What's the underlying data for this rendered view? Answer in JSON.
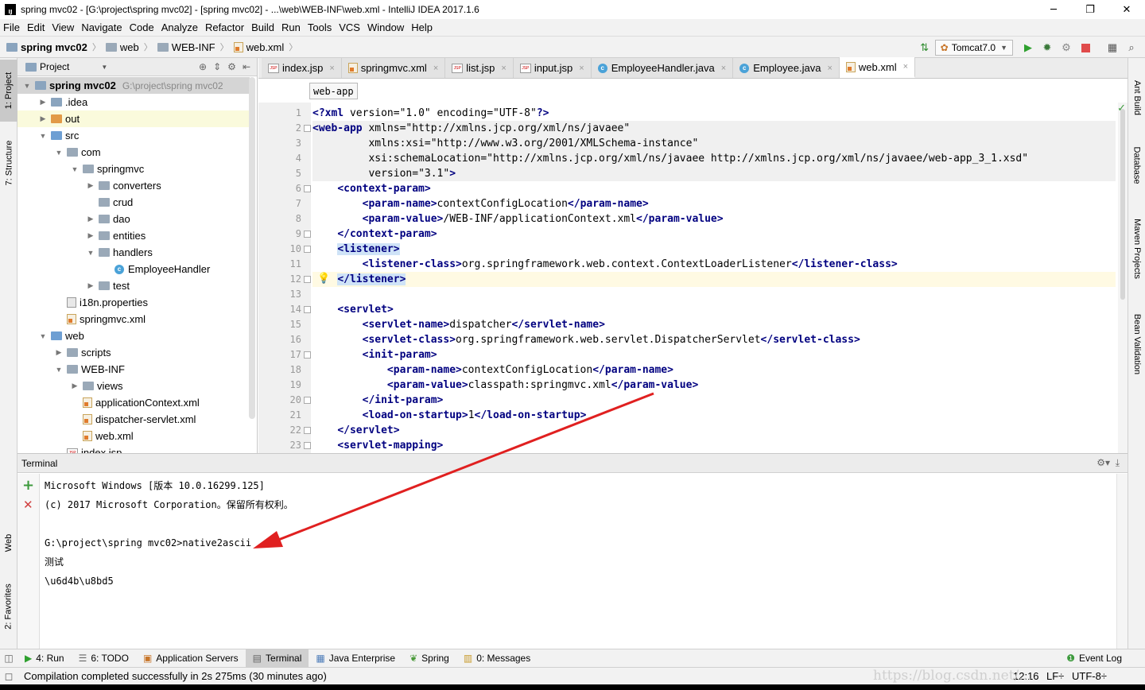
{
  "window": {
    "title": "spring mvc02 - [G:\\project\\spring mvc02] - [spring mvc02] - ...\\web\\WEB-INF\\web.xml - IntelliJ IDEA 2017.1.6",
    "logo": "IJ",
    "minimize": "─",
    "maximize": "❐",
    "close": "✕"
  },
  "menu": [
    "File",
    "Edit",
    "View",
    "Navigate",
    "Code",
    "Analyze",
    "Refactor",
    "Build",
    "Run",
    "Tools",
    "VCS",
    "Window",
    "Help"
  ],
  "breadcrumbs": [
    "spring mvc02",
    "web",
    "WEB-INF",
    "web.xml"
  ],
  "runconfig": {
    "name": "Tomcat7.0"
  },
  "leftstrip": [
    "1: Project",
    "7: Structure",
    "Web",
    "2: Favorites"
  ],
  "rightstrip": [
    "Ant Build",
    "Database",
    "Maven Projects",
    "Bean Validation"
  ],
  "project": {
    "header": "Project",
    "tree": [
      {
        "label": "spring mvc02",
        "path": "G:\\project\\spring mvc02",
        "depth": 0,
        "arrow": "▼",
        "icon": "folder",
        "bold": true
      },
      {
        "label": ".idea",
        "depth": 1,
        "arrow": "▶",
        "icon": "folder"
      },
      {
        "label": "out",
        "depth": 1,
        "arrow": "▶",
        "icon": "folder-orange"
      },
      {
        "label": "src",
        "depth": 1,
        "arrow": "▼",
        "icon": "folder-blue"
      },
      {
        "label": "com",
        "depth": 2,
        "arrow": "▼",
        "icon": "folder-gray"
      },
      {
        "label": "springmvc",
        "depth": 3,
        "arrow": "▼",
        "icon": "folder-gray"
      },
      {
        "label": "converters",
        "depth": 4,
        "arrow": "▶",
        "icon": "folder-gray"
      },
      {
        "label": "crud",
        "depth": 4,
        "arrow": "",
        "icon": "folder-gray"
      },
      {
        "label": "dao",
        "depth": 4,
        "arrow": "▶",
        "icon": "folder-gray"
      },
      {
        "label": "entities",
        "depth": 4,
        "arrow": "▶",
        "icon": "folder-gray"
      },
      {
        "label": "handlers",
        "depth": 4,
        "arrow": "▼",
        "icon": "folder-gray"
      },
      {
        "label": "EmployeeHandler",
        "depth": 5,
        "arrow": "",
        "icon": "class"
      },
      {
        "label": "test",
        "depth": 4,
        "arrow": "▶",
        "icon": "folder-gray"
      },
      {
        "label": "i18n.properties",
        "depth": 2,
        "arrow": "",
        "icon": "prop"
      },
      {
        "label": "springmvc.xml",
        "depth": 2,
        "arrow": "",
        "icon": "xml"
      },
      {
        "label": "web",
        "depth": 1,
        "arrow": "▼",
        "icon": "folder-blue"
      },
      {
        "label": "scripts",
        "depth": 2,
        "arrow": "▶",
        "icon": "folder-gray"
      },
      {
        "label": "WEB-INF",
        "depth": 2,
        "arrow": "▼",
        "icon": "folder-gray"
      },
      {
        "label": "views",
        "depth": 3,
        "arrow": "▶",
        "icon": "folder-gray"
      },
      {
        "label": "applicationContext.xml",
        "depth": 3,
        "arrow": "",
        "icon": "xml"
      },
      {
        "label": "dispatcher-servlet.xml",
        "depth": 3,
        "arrow": "",
        "icon": "xml"
      },
      {
        "label": "web.xml",
        "depth": 3,
        "arrow": "",
        "icon": "xml"
      },
      {
        "label": "index.jsp",
        "depth": 2,
        "arrow": "",
        "icon": "jsp"
      }
    ]
  },
  "tabs": [
    {
      "label": "index.jsp",
      "icon": "jsp"
    },
    {
      "label": "springmvc.xml",
      "icon": "xml"
    },
    {
      "label": "list.jsp",
      "icon": "jsp"
    },
    {
      "label": "input.jsp",
      "icon": "jsp"
    },
    {
      "label": "EmployeeHandler.java",
      "icon": "class"
    },
    {
      "label": "Employee.java",
      "icon": "class"
    },
    {
      "label": "web.xml",
      "icon": "xml",
      "active": true
    }
  ],
  "tab_close": "×",
  "crumb_tip": "web-app",
  "code": [
    "<?xml version=\"1.0\" encoding=\"UTF-8\"?>",
    "<web-app xmlns=\"http://xmlns.jcp.org/xml/ns/javaee\"",
    "         xmlns:xsi=\"http://www.w3.org/2001/XMLSchema-instance\"",
    "         xsi:schemaLocation=\"http://xmlns.jcp.org/xml/ns/javaee http://xmlns.jcp.org/xml/ns/javaee/web-app_3_1.xsd\"",
    "         version=\"3.1\">",
    "    <context-param>",
    "        <param-name>contextConfigLocation</param-name>",
    "        <param-value>/WEB-INF/applicationContext.xml</param-value>",
    "    </context-param>",
    "    <listener>",
    "        <listener-class>org.springframework.web.context.ContextLoaderListener</listener-class>",
    "    </listener>",
    "",
    "    <servlet>",
    "        <servlet-name>dispatcher</servlet-name>",
    "        <servlet-class>org.springframework.web.servlet.DispatcherServlet</servlet-class>",
    "        <init-param>",
    "            <param-name>contextConfigLocation</param-name>",
    "            <param-value>classpath:springmvc.xml</param-value>",
    "        </init-param>",
    "        <load-on-startup>1</load-on-startup>",
    "    </servlet>",
    "    <servlet-mapping>"
  ],
  "terminal": {
    "title": "Terminal",
    "lines": [
      "Microsoft Windows [版本 10.0.16299.125]",
      "(c) 2017 Microsoft Corporation。保留所有权利。",
      "",
      "G:\\project\\spring mvc02>native2ascii",
      "测试",
      "\\u6d4b\\u8bd5"
    ]
  },
  "bottomtabs": [
    {
      "label": "4: Run",
      "icon": "▶"
    },
    {
      "label": "6: TODO",
      "icon": "☰"
    },
    {
      "label": "Application Servers",
      "icon": "▣"
    },
    {
      "label": "Terminal",
      "icon": "▤",
      "active": true
    },
    {
      "label": "Java Enterprise",
      "icon": "▦"
    },
    {
      "label": "Spring",
      "icon": "❦"
    },
    {
      "label": "0: Messages",
      "icon": "▥"
    }
  ],
  "eventlog": "Event Log",
  "status": {
    "message": "Compilation completed successfully in 2s 275ms (30 minutes ago)",
    "position": "12:16",
    "lineend": "LF÷",
    "encoding": "UTF-8÷"
  },
  "watermark": "https://blog.csdn.net/..."
}
